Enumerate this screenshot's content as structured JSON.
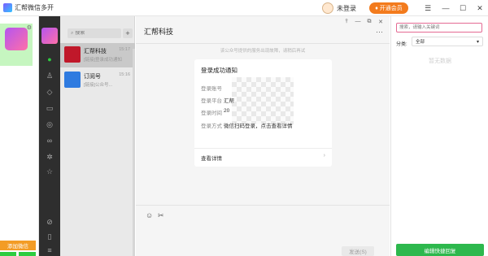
{
  "app": {
    "title": "汇帮微信多开",
    "user_label": "未登录",
    "vip_label": "开通会员"
  },
  "window_controls": {
    "menu": "☰",
    "minimize": "—",
    "maximize": "☐",
    "close": "✕"
  },
  "accounts": {
    "add_label": "添加微信"
  },
  "chat_list": {
    "search_placeholder": "搜索",
    "plus": "+",
    "items": [
      {
        "name": "汇帮科技",
        "time": "15:17",
        "preview": "[链接]登录成功通知"
      },
      {
        "name": "订阅号",
        "time": "15:16",
        "preview": "[链接]公众号..."
      }
    ]
  },
  "chat": {
    "title": "汇帮科技",
    "top_ctrls": [
      "⫯",
      "—",
      "⧉",
      "✕"
    ],
    "more": "···",
    "notice": "该公众号提供的服务出现故障，请稍后再试",
    "card": {
      "title": "登录成功通知",
      "rows": [
        {
          "label": "登录账号",
          "value": ""
        },
        {
          "label": "登录平台",
          "value": "汇帮"
        },
        {
          "label": "登录时间",
          "value": "20"
        },
        {
          "label": "登录方式",
          "value": "微信扫码登录，点击查看详情"
        }
      ],
      "link": "查看详情",
      "arrow": "›"
    },
    "send_label": "发送(S)"
  },
  "right_panel": {
    "search_placeholder": "搜索，请输入关键词",
    "category_label": "分类:",
    "category_value": "全部",
    "empty_text": "暂无数据",
    "button_label": "编辑快捷回复"
  }
}
